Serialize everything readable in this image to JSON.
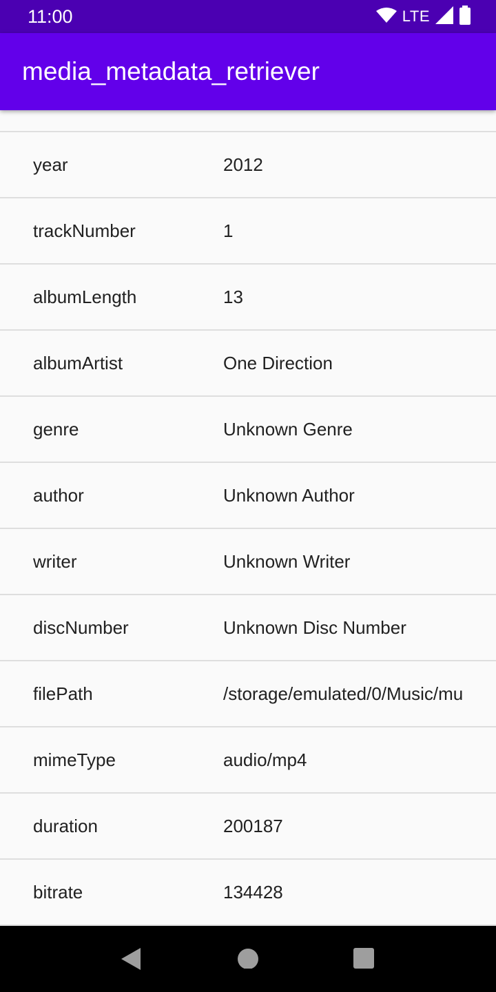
{
  "status_bar": {
    "time": "11:00",
    "network": "LTE",
    "icons": [
      "wifi-icon",
      "cell-signal-icon",
      "battery-icon"
    ]
  },
  "app_bar": {
    "title": "media_metadata_retriever",
    "color": "#6200ea"
  },
  "metadata": [
    {
      "key": "year",
      "value": "2012"
    },
    {
      "key": "trackNumber",
      "value": "1"
    },
    {
      "key": "albumLength",
      "value": "13"
    },
    {
      "key": "albumArtist",
      "value": "One Direction"
    },
    {
      "key": "genre",
      "value": "Unknown Genre"
    },
    {
      "key": "author",
      "value": "Unknown Author"
    },
    {
      "key": "writer",
      "value": "Unknown Writer"
    },
    {
      "key": "discNumber",
      "value": "Unknown Disc Number"
    },
    {
      "key": "filePath",
      "value": "/storage/emulated/0/Music/mu"
    },
    {
      "key": "mimeType",
      "value": "audio/mp4"
    },
    {
      "key": "duration",
      "value": "200187"
    },
    {
      "key": "bitrate",
      "value": "134428"
    }
  ],
  "nav_bar": {
    "buttons": [
      "back-icon",
      "home-icon",
      "recents-icon"
    ]
  }
}
